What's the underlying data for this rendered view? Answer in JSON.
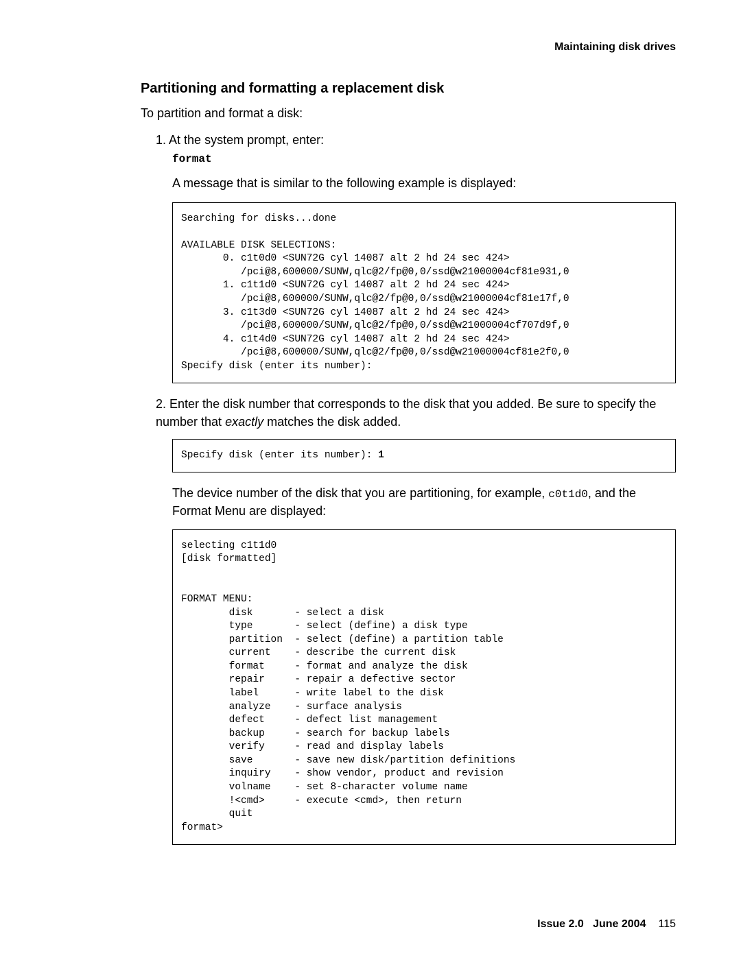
{
  "header_right": "Maintaining disk drives",
  "heading": "Partitioning and formatting a replacement disk",
  "intro": "To partition and format a disk:",
  "step1_num": "1.",
  "step1_text": "At the system prompt, enter:",
  "step1_cmd": "format",
  "step1_note": "A message that is similar to the following example is displayed:",
  "code1": "Searching for disks...done\n\nAVAILABLE DISK SELECTIONS:\n       0. c1t0d0 <SUN72G cyl 14087 alt 2 hd 24 sec 424>\n          /pci@8,600000/SUNW,qlc@2/fp@0,0/ssd@w21000004cf81e931,0\n       1. c1t1d0 <SUN72G cyl 14087 alt 2 hd 24 sec 424>\n          /pci@8,600000/SUNW,qlc@2/fp@0,0/ssd@w21000004cf81e17f,0\n       3. c1t3d0 <SUN72G cyl 14087 alt 2 hd 24 sec 424>\n          /pci@8,600000/SUNW,qlc@2/fp@0,0/ssd@w21000004cf707d9f,0\n       4. c1t4d0 <SUN72G cyl 14087 alt 2 hd 24 sec 424>\n          /pci@8,600000/SUNW,qlc@2/fp@0,0/ssd@w21000004cf81e2f0,0\nSpecify disk (enter its number):",
  "step2_num": "2.",
  "step2_text_1": "Enter the disk number that corresponds to the disk that you added. Be sure to specify the number that ",
  "step2_text_italic": "exactly",
  "step2_text_2": " matches the disk added.",
  "code2_prefix": "Specify disk (enter its number): ",
  "code2_input": "1",
  "step2_note_1": "The device number of the disk that you are partitioning, for example, ",
  "step2_note_mono": "c0t1d0",
  "step2_note_2": ", and the Format Menu are displayed:",
  "code3": "selecting c1t1d0\n[disk formatted]\n\n\nFORMAT MENU:\n        disk       - select a disk\n        type       - select (define) a disk type\n        partition  - select (define) a partition table\n        current    - describe the current disk\n        format     - format and analyze the disk\n        repair     - repair a defective sector\n        label      - write label to the disk\n        analyze    - surface analysis\n        defect     - defect list management\n        backup     - search for backup labels\n        verify     - read and display labels\n        save       - save new disk/partition definitions\n        inquiry    - show vendor, product and revision\n        volname    - set 8-character volume name\n        !<cmd>     - execute <cmd>, then return\n        quit\nformat>",
  "footer_issue": "Issue 2.0",
  "footer_date": "June 2004",
  "footer_page": "115"
}
